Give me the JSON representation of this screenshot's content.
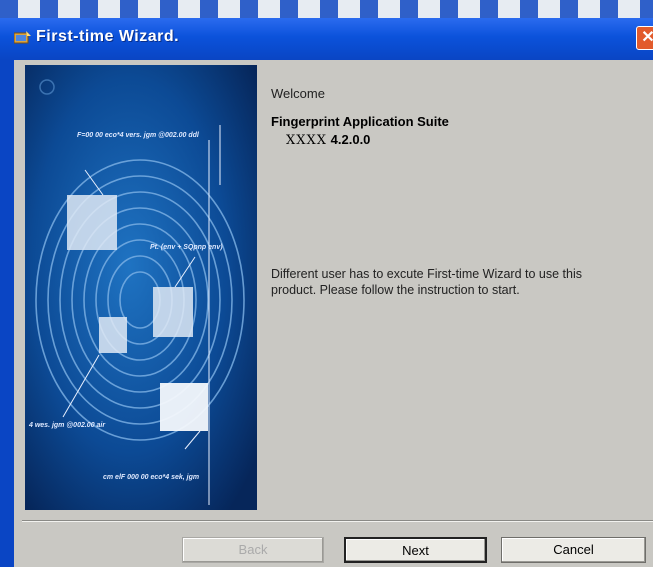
{
  "window": {
    "title": "First-time Wizard.",
    "close_glyph": "✕"
  },
  "content": {
    "welcome": "Welcome",
    "product_name": "Fingerprint Application Suite",
    "version_label": "XXXX",
    "version_number": "4.2.0.0",
    "description": "Different user has to excute First-time Wizard to use this product. Please follow the instruction to start."
  },
  "image_labels": [
    "F=00 00 eco*4 vers. jgm @002.00 ddl",
    "Pt. (env + SQpnp env)",
    "4 wes. jgm @002.00 air",
    "cm elF 000 00 eco*4 sek, jgm"
  ],
  "buttons": {
    "back": "Back",
    "next": "Next",
    "cancel": "Cancel"
  },
  "colors": {
    "titlebar": "#0b52db",
    "panel_bg": "#c9c8c3",
    "image_bg": "#0b3d86"
  }
}
